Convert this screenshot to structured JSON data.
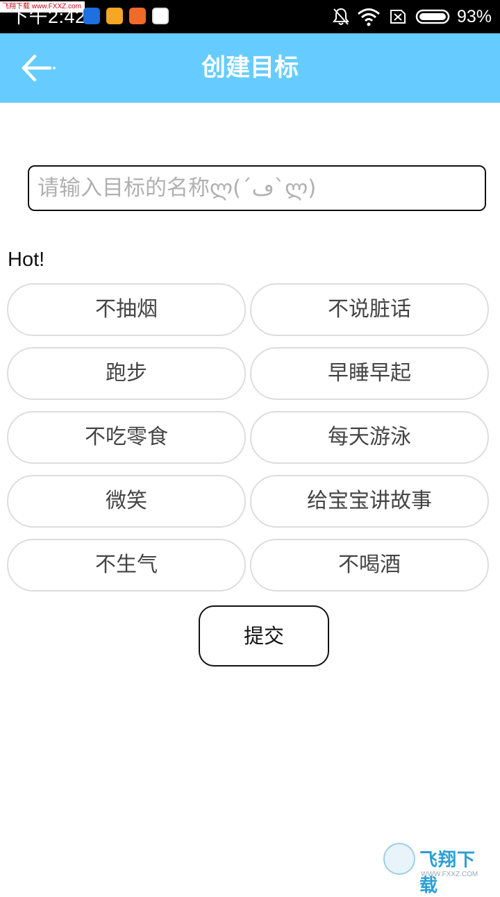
{
  "status_bar": {
    "time": "下午2:42",
    "watermark": "飞翔下载 www.FXXZ.com",
    "battery": "93%"
  },
  "app_bar": {
    "title": "创建目标",
    "back_icon": "arrow-left-icon"
  },
  "goal_input": {
    "value": "",
    "placeholder": "请输入目标的名称ლ(´ڡ`ლ)"
  },
  "hot": {
    "label": "Hot!",
    "tags": [
      "不抽烟",
      "不说脏话",
      "跑步",
      "早睡早起",
      "不吃零食",
      "每天游泳",
      "微笑",
      "给宝宝讲故事",
      "不生气",
      "不喝酒"
    ]
  },
  "submit": {
    "label": "提交"
  },
  "watermark_bottom": {
    "text": "飞翔下载",
    "url": "WWW.FXXZ.COM"
  },
  "colors": {
    "accent": "#66ccff",
    "tag_border": "#dddddd"
  }
}
